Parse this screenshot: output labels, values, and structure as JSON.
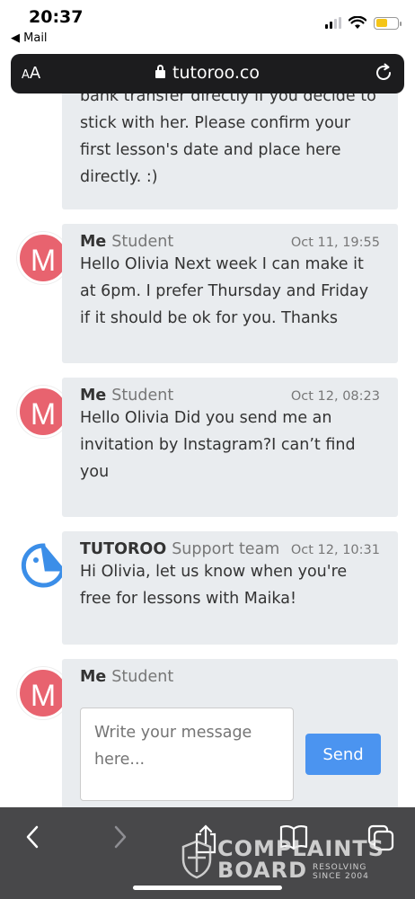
{
  "status_bar": {
    "time": "20:37",
    "back_app": "◀ Mail"
  },
  "url_bar": {
    "aa_small": "A",
    "aa_big": "A",
    "domain": "tutoroo.co"
  },
  "messages": [
    {
      "text": "bank transfer directly if you decide to stick with her. Please confirm your first lesson's date and place here directly. :)"
    },
    {
      "name": "Me",
      "role": "Student",
      "date": "Oct 11, 19:55",
      "avatar": "M",
      "text": "Hello Olivia Next week I can make it at 6pm. I prefer Thursday and Friday if it should be ok for you. Thanks"
    },
    {
      "name": "Me",
      "role": "Student",
      "date": "Oct 12, 08:23",
      "avatar": "M",
      "text": "Hello Olivia Did you send me an invitation by Instagram?I can’t find you"
    },
    {
      "name": "TUTOROO",
      "role": "Support team",
      "date": "Oct 12, 10:31",
      "text": "Hi Olivia, let us know when you're free for lessons with Maika!"
    }
  ],
  "compose": {
    "name": "Me",
    "role": "Student",
    "avatar": "M",
    "placeholder": "Write your message here...",
    "send_label": "Send"
  },
  "watermark": {
    "line1": "COMPLAINTS",
    "line2": "BOARD",
    "tag1": "RESOLVING",
    "tag2": "SINCE 2004"
  },
  "colors": {
    "accent": "#4b94f0",
    "avatar": "#e8636f",
    "bubble": "#e9ecef",
    "toolbar": "#48484a"
  }
}
